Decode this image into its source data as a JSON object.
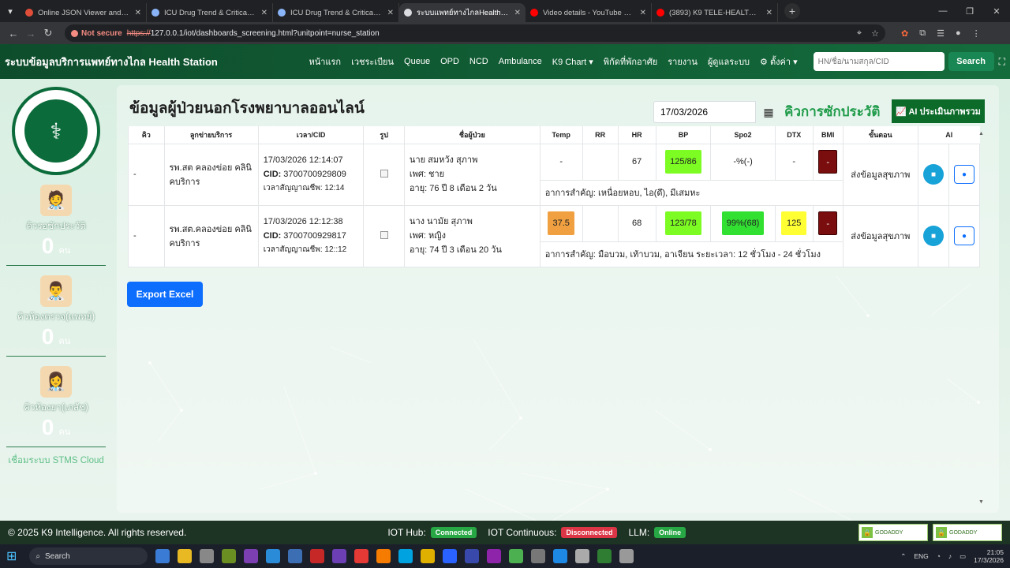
{
  "browser": {
    "tabs": [
      {
        "title": "Online JSON Viewer and Forma",
        "color": "#e04e39",
        "active": false
      },
      {
        "title": "ICU Drug Trend & Critical Care",
        "color": "#8ab4f8",
        "active": false
      },
      {
        "title": "ICU Drug Trend & Critical Care",
        "color": "#8ab4f8",
        "active": false
      },
      {
        "title": "ระบบแพทย์ทางไกลHealth Station",
        "color": "#dadce0",
        "active": true
      },
      {
        "title": "Video details - YouTube Studio",
        "color": "#ff0000",
        "active": false
      },
      {
        "title": "(3893) K9 TELE-HEALTH AI Vers",
        "color": "#ff0000",
        "active": false
      }
    ],
    "security_label": "Not secure",
    "url_scheme": "https://",
    "url_rest": "127.0.0.1/iot/dashboards_screening.html?unitpoint=nurse_station"
  },
  "nav": {
    "brand": "ระบบข้อมูลบริการแพทย์ทางไกล Health Station",
    "links": [
      "หน้าแรก",
      "เวชระเบียน",
      "Queue",
      "OPD",
      "NCD",
      "Ambulance",
      "K9 Chart ▾",
      "พิกัดที่พักอาศัย",
      "รายงาน",
      "ผู้ดูแลระบบ",
      "⚙ ตั้งค่า ▾"
    ],
    "search_placeholder": "HN/ชื่อ/นามสกุล/CID",
    "search_button": "Search"
  },
  "sidebar": {
    "seal_text": "MINISTRY OF PUBLIC HEALTH",
    "queues": [
      {
        "label": "คิวรอซักประวัติ",
        "count": "0",
        "unit": "คน",
        "icon": "🧑‍⚕️"
      },
      {
        "label": "คิวห้องตรวจ(แพทย์)",
        "count": "0",
        "unit": "คน",
        "icon": "👨‍⚕️"
      },
      {
        "label": "คิวห้องยา(เภสัช)",
        "count": "0",
        "unit": "คน",
        "icon": "👩‍⚕️"
      }
    ],
    "stms": "เชื่อมระบบ STMS Cloud"
  },
  "main": {
    "title": "ข้อมูลผู้ป่วยนอกโรงพยาบาลออนไลน์",
    "date": "17/03/2026",
    "history_label": "คิวการซักประวัติ",
    "ai_button": "AI ประเมินภาพรวม",
    "headers": [
      "คิว",
      "ลูกข่ายบริการ",
      "เวลา/CID",
      "รูป",
      "ชื่อผู้ป่วย",
      "Temp",
      "RR",
      "HR",
      "BP",
      "Spo2",
      "DTX",
      "BMI",
      "ขั้นตอน",
      "AI"
    ],
    "rows": [
      {
        "queue": "-",
        "unit": "รพ.สต คลองข่อย คลินิคบริการ",
        "time": "17/03/2026 12:14:07",
        "cid_label": "CID:",
        "cid": "3700700929809",
        "appt": "เวลาสัญญาณชีพ: 12:14",
        "name": "นาย สมหวัง สุภาพ",
        "sex": "เพศ: ชาย",
        "age": "อายุ: 76 ปี 8 เดือน 2 วัน",
        "temp": "-",
        "temp_color": "",
        "rr": "",
        "hr": "67",
        "bp": "125/86",
        "bp_color": "#7cfc22",
        "spo2": "-%(-)",
        "spo2_color": "",
        "dtx": "-",
        "dtx_color": "",
        "bmi": "-",
        "step": "ส่งข้อมูลสุขภาพ",
        "symptoms": "อาการสำคัญ: เหนื่อยหอบ, ไอ(ดึ), มีเสมหะ"
      },
      {
        "queue": "-",
        "unit": "รพ.สต.คลองข่อย คลินิคบริการ",
        "time": "17/03/2026 12:12:38",
        "cid_label": "CID:",
        "cid": "3700700929817",
        "appt": "เวลาสัญญาณชีพ: 12::12",
        "name": "นาง นามัย สุภาพ",
        "sex": "เพศ: หญิง",
        "age": "อายุ: 74 ปี 3 เดือน 20 วัน",
        "temp": "37.5",
        "temp_color": "#f0a040",
        "rr": "",
        "hr": "68",
        "bp": "123/78",
        "bp_color": "#7cfc22",
        "spo2": "99%(68)",
        "spo2_color": "#32e032",
        "dtx": "125",
        "dtx_color": "#ffff33",
        "bmi": "-",
        "step": "ส่งข้อมูลสุขภาพ",
        "symptoms": "อาการสำคัญ: มือบวม, เท้าบวม, อาเจียน ระยะเวลา: 12 ชั่วโมง - 24 ชั่วโมง"
      }
    ],
    "export_button": "Export Excel"
  },
  "footer": {
    "copyright": "© 2025 K9 Intelligence. All rights reserved.",
    "iot_hub_label": "IOT Hub:",
    "iot_hub_status": "Connected",
    "iot_cont_label": "IOT Continuous:",
    "iot_cont_status": "Disconnected",
    "llm_label": "LLM:",
    "llm_status": "Online",
    "badge_text": "GODADDY"
  },
  "taskbar": {
    "search": "Search",
    "lang": "ENG",
    "time": "21:05",
    "date": "17/3/2026"
  },
  "colors": {
    "nav_bg": "#146c3c",
    "connected": "#28a745",
    "disconnected": "#dc3545",
    "online": "#28a745"
  }
}
